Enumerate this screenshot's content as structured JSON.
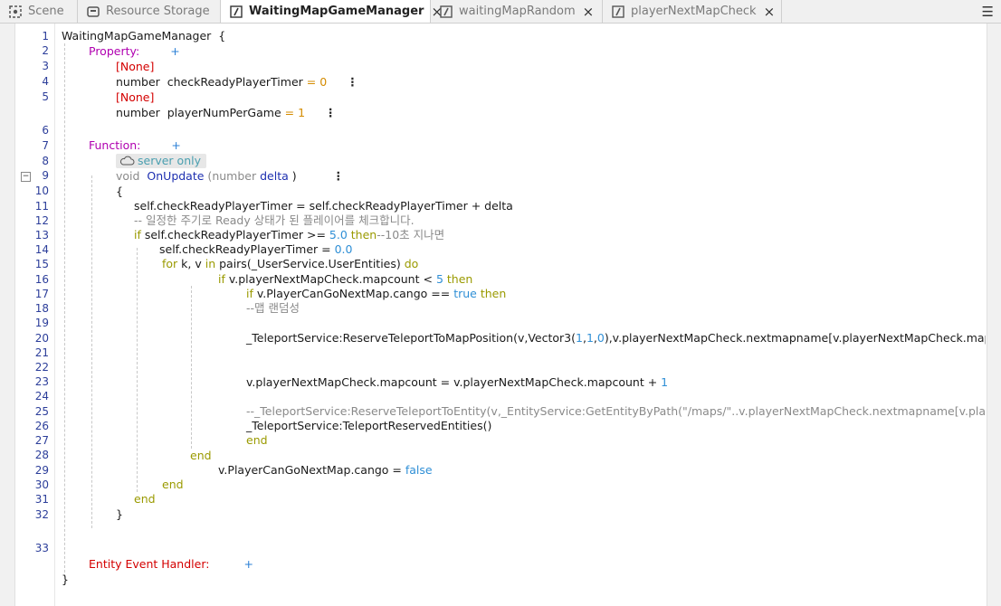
{
  "tabs": [
    {
      "label": "Scene",
      "icon": "scene-icon",
      "active": false
    },
    {
      "label": "Resource Storage",
      "icon": "storage-icon",
      "active": false
    },
    {
      "label": "WaitingMapGameManager",
      "icon": "script-icon",
      "active": true,
      "close": "×"
    },
    {
      "label": "waitingMapRandom",
      "icon": "script-icon",
      "active": false,
      "close": "×"
    },
    {
      "label": "playerNextMapCheck",
      "icon": "script-icon",
      "active": false,
      "close": "×"
    }
  ],
  "menu_icon": "☰",
  "line_numbers": [
    "1",
    "2",
    "3",
    "4",
    "5",
    "6",
    "7",
    "8",
    "9",
    "10",
    "11",
    "12",
    "13",
    "14",
    "15",
    "16",
    "17",
    "18",
    "19",
    "20",
    "21",
    "22",
    "23",
    "24",
    "25",
    "26",
    "27",
    "28",
    "29",
    "30",
    "31",
    "32",
    "33"
  ],
  "code": {
    "class_name": "WaitingMapGameManager",
    "open_brace": "{",
    "close_brace": "}",
    "property_label": "Property:",
    "plus": "+",
    "none_tag": "[None]",
    "prop1_type": "number",
    "prop1_name": "checkReadyPlayerTimer",
    "prop1_eq": "=",
    "prop1_value": "0",
    "prop2_type": "number",
    "prop2_name": "playerNumPerGame",
    "prop2_eq": "=",
    "prop2_value": "1",
    "more": "⋮",
    "function_label": "Function:",
    "server_only": "server only",
    "fn_void": "void",
    "fn_name": "OnUpdate",
    "fn_paren_open": "(",
    "fn_param_type": "number",
    "fn_param": "delta",
    "fn_paren_close": ")",
    "l11": "self.checkReadyPlayerTimer = self.checkReadyPlayerTimer + delta",
    "l12": "-- 일정한 주기로 Ready 상태가 된 플레이어를 체크합니다.",
    "l13_if": "if",
    "l13_mid": " self.checkReadyPlayerTimer >= ",
    "l13_num": "5.0",
    "l13_then": " then",
    "l13_cmt": "--10초 지나면",
    "l14_pre": "self.checkReadyPlayerTimer = ",
    "l14_num": "0.0",
    "l15_for": "for",
    "l15_mid": " k, v ",
    "l15_in": "in",
    "l15_rest": " pairs(_UserService.UserEntities) ",
    "l15_do": "do",
    "l16_if": "if",
    "l16_mid": " v.playerNextMapCheck.mapcount < ",
    "l16_num": "5",
    "l16_then": " then",
    "l17_if": "if",
    "l17_mid": " v.PlayerCanGoNextMap.cango == ",
    "l17_bool": "true",
    "l17_then": " then",
    "l18": "--맵 랜덤성",
    "l20_pre": "_TeleportService:ReserveTeleportToMapPosition(v,Vector3(",
    "l20_n1": "1",
    "l20_c1": ",",
    "l20_n2": "1",
    "l20_c2": ",",
    "l20_n3": "0",
    "l20_post": "),v.playerNextMapCheck.nextmapname[v.playerNextMapCheck.mapcount])",
    "l23_pre": "v.playerNextMapCheck.mapcount = v.playerNextMapCheck.mapcount + ",
    "l23_num": "1",
    "l25": "--_TeleportService:ReserveTeleportToEntity(v,_EntityService:GetEntityByPath(\"/maps/\"..v.playerNextMapCheck.nextmapname[v.playerNextMapCheck.mapcount]))",
    "l26": "_TeleportService:TeleportReservedEntities()",
    "end": "end",
    "l29_pre": "v.PlayerCanGoNextMap.cango = ",
    "l29_bool": "false",
    "entity_event_label": "Entity Event Handler:"
  }
}
